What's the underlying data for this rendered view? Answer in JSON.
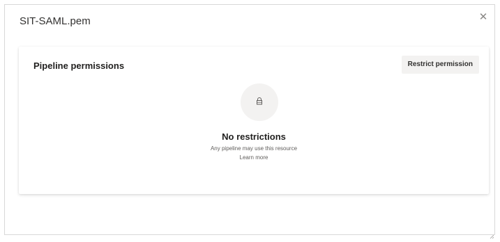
{
  "dialog": {
    "title": "SIT-SAML.pem",
    "close_icon": "close-icon",
    "close_glyph": "✕"
  },
  "card": {
    "title": "Pipeline permissions",
    "restrict_button_label": "Restrict permission",
    "empty_state": {
      "icon": "lock-icon",
      "title": "No restrictions",
      "description": "Any pipeline may use this resource",
      "link_label": "Learn more"
    }
  },
  "colors": {
    "border": "#d8d8d8",
    "button_bg": "#f3f2f1",
    "icon_circle_bg": "#f3f2f1",
    "text_primary": "#201f1e",
    "text_secondary": "#605e5c"
  }
}
